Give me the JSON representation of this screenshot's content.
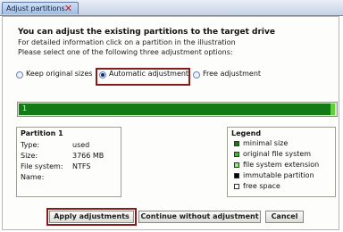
{
  "window": {
    "tab_title": "Adjust partitions",
    "close_icon": "close-icon"
  },
  "intro": {
    "heading": "You can adjust the existing partitions to the target drive",
    "line1": "For detailed information click on a partition in the illustration",
    "line2": "Please select one of the following three adjustment options:"
  },
  "options": {
    "keep": "Keep original sizes",
    "automatic": "Automatic adjustment",
    "free": "Free adjustment",
    "selected": "automatic"
  },
  "partition_bar": {
    "label": "1",
    "used_color": "#137b16",
    "extension_color": "#5fd13c"
  },
  "partition_info": {
    "title": "Partition 1",
    "type_label": "Type:",
    "type_value": "used",
    "size_label": "Size:",
    "size_value": "3766 MB",
    "fs_label": "File system:",
    "fs_value": "NTFS",
    "name_label": "Name:",
    "name_value": ""
  },
  "legend": {
    "title": "Legend",
    "items": [
      {
        "label": "minimal size",
        "color": "#137b16"
      },
      {
        "label": "original file system",
        "color": "#35c027"
      },
      {
        "label": "file system extension",
        "color": "#8ff06b"
      },
      {
        "label": "immutable partition",
        "color": "#000000"
      },
      {
        "label": "free space",
        "color": "#ffffff"
      }
    ]
  },
  "buttons": {
    "apply": "Apply adjustments",
    "continue": "Continue without adjustment",
    "cancel": "Cancel"
  },
  "accent_highlight": "#8a1b1b"
}
